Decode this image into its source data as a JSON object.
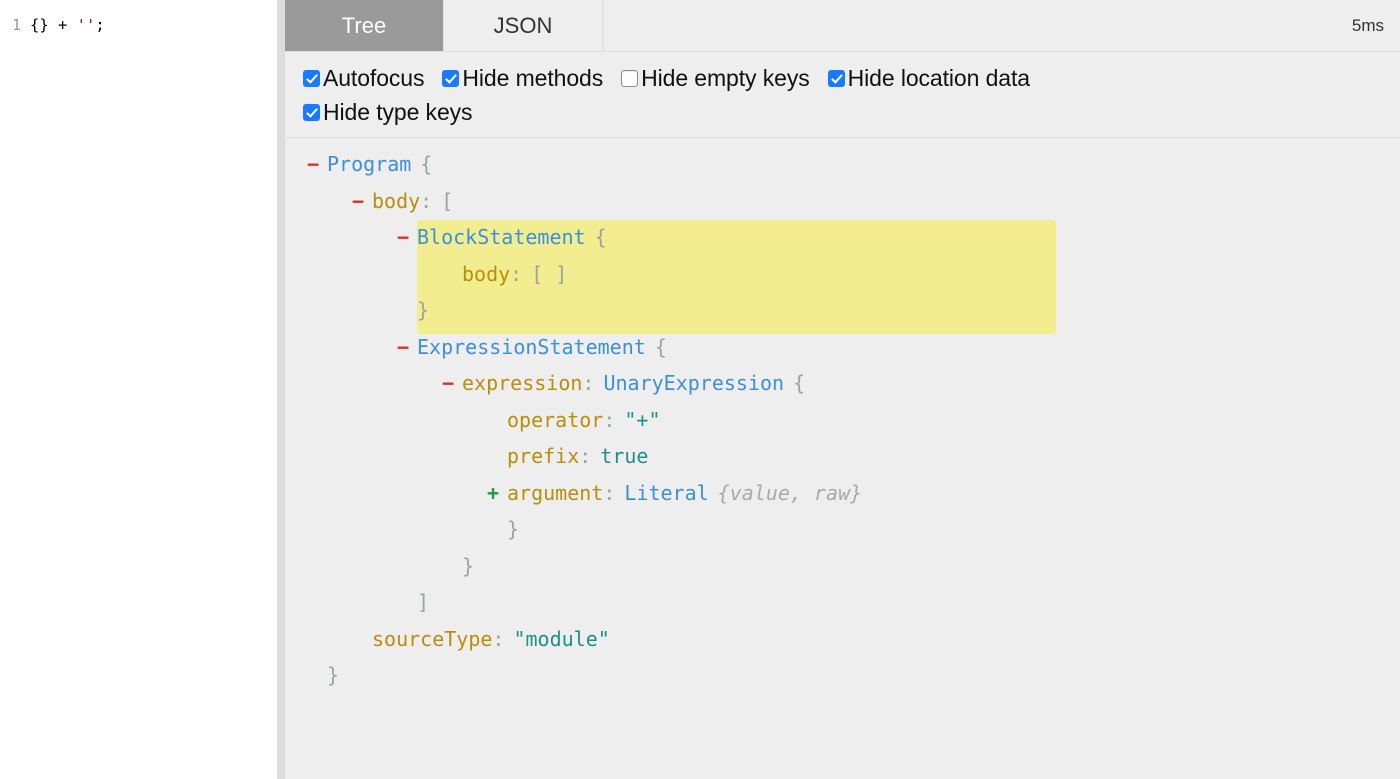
{
  "editor": {
    "line_number": "1",
    "code_segments": [
      {
        "text": "{} ",
        "kind": "punct"
      },
      {
        "text": "+ ",
        "kind": "op"
      },
      {
        "text": "''",
        "kind": "string"
      },
      {
        "text": ";",
        "kind": "punct"
      }
    ],
    "code_full": "{} + '';"
  },
  "tabs": {
    "items": [
      {
        "label": "Tree",
        "active": true
      },
      {
        "label": "JSON",
        "active": false
      }
    ],
    "timing": "5ms"
  },
  "options": [
    {
      "label": "Autofocus",
      "checked": true
    },
    {
      "label": "Hide methods",
      "checked": true
    },
    {
      "label": "Hide empty keys",
      "checked": false
    },
    {
      "label": "Hide location data",
      "checked": true
    },
    {
      "label": "Hide type keys",
      "checked": true
    }
  ],
  "tree": {
    "highlight_color": "#f2ee8f",
    "rows": [
      {
        "indent": 0,
        "toggle": "minus",
        "highlight": false,
        "tokens": [
          {
            "text": "Program",
            "kind": "type"
          },
          {
            "text": " ",
            "kind": "space"
          },
          {
            "text": "{",
            "kind": "punct"
          }
        ]
      },
      {
        "indent": 1,
        "toggle": "minus",
        "highlight": false,
        "tokens": [
          {
            "text": "body",
            "kind": "key"
          },
          {
            "text": ":",
            "kind": "colon"
          },
          {
            "text": " ",
            "kind": "space"
          },
          {
            "text": "[",
            "kind": "punct"
          }
        ]
      },
      {
        "indent": 2,
        "toggle": "minus",
        "highlight": true,
        "tokens": [
          {
            "text": "BlockStatement",
            "kind": "type"
          },
          {
            "text": " ",
            "kind": "space"
          },
          {
            "text": "{",
            "kind": "punct"
          }
        ]
      },
      {
        "indent": 3,
        "toggle": "none",
        "highlight": true,
        "tokens": [
          {
            "text": "body",
            "kind": "key"
          },
          {
            "text": ":",
            "kind": "colon"
          },
          {
            "text": " ",
            "kind": "space"
          },
          {
            "text": "[ ]",
            "kind": "punct"
          }
        ]
      },
      {
        "indent": 2,
        "toggle": "none",
        "highlight": true,
        "tokens": [
          {
            "text": "}",
            "kind": "punct"
          }
        ]
      },
      {
        "indent": 2,
        "toggle": "minus",
        "highlight": false,
        "tokens": [
          {
            "text": "ExpressionStatement",
            "kind": "type"
          },
          {
            "text": " ",
            "kind": "space"
          },
          {
            "text": "{",
            "kind": "punct"
          }
        ]
      },
      {
        "indent": 3,
        "toggle": "minus",
        "highlight": false,
        "tokens": [
          {
            "text": "expression",
            "kind": "key"
          },
          {
            "text": ":",
            "kind": "colon"
          },
          {
            "text": " ",
            "kind": "space"
          },
          {
            "text": "UnaryExpression",
            "kind": "type"
          },
          {
            "text": " ",
            "kind": "space"
          },
          {
            "text": "{",
            "kind": "punct"
          }
        ]
      },
      {
        "indent": 4,
        "toggle": "none",
        "highlight": false,
        "tokens": [
          {
            "text": "operator",
            "kind": "key"
          },
          {
            "text": ":",
            "kind": "colon"
          },
          {
            "text": " ",
            "kind": "space"
          },
          {
            "text": "\"+\"",
            "kind": "string"
          }
        ]
      },
      {
        "indent": 4,
        "toggle": "none",
        "highlight": false,
        "tokens": [
          {
            "text": "prefix",
            "kind": "key"
          },
          {
            "text": ":",
            "kind": "colon"
          },
          {
            "text": " ",
            "kind": "space"
          },
          {
            "text": "true",
            "kind": "bool"
          }
        ]
      },
      {
        "indent": 4,
        "toggle": "plus",
        "highlight": false,
        "tokens": [
          {
            "text": "argument",
            "kind": "key"
          },
          {
            "text": ":",
            "kind": "colon"
          },
          {
            "text": " ",
            "kind": "space"
          },
          {
            "text": "Literal",
            "kind": "type"
          },
          {
            "text": " ",
            "kind": "space"
          },
          {
            "text": "{value, raw}",
            "kind": "hint"
          }
        ]
      },
      {
        "indent": 4,
        "toggle": "none",
        "highlight": false,
        "tokens": [
          {
            "text": "}",
            "kind": "punct"
          }
        ]
      },
      {
        "indent": 3,
        "toggle": "none",
        "highlight": false,
        "tokens": [
          {
            "text": "}",
            "kind": "punct"
          }
        ]
      },
      {
        "indent": 2,
        "toggle": "none",
        "highlight": false,
        "tokens": [
          {
            "text": "]",
            "kind": "punct"
          }
        ]
      },
      {
        "indent": 1,
        "toggle": "none",
        "highlight": false,
        "tokens": [
          {
            "text": "sourceType",
            "kind": "key"
          },
          {
            "text": ":",
            "kind": "colon"
          },
          {
            "text": " ",
            "kind": "space"
          },
          {
            "text": "\"module\"",
            "kind": "string"
          }
        ]
      },
      {
        "indent": 0,
        "toggle": "none",
        "highlight": false,
        "tokens": [
          {
            "text": "}",
            "kind": "punct"
          }
        ]
      }
    ]
  }
}
